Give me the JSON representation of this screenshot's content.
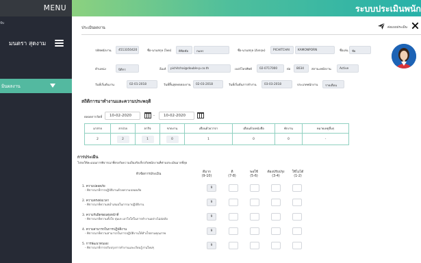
{
  "sidebar": {
    "menu_label": "MENU",
    "role_text": "จับ",
    "user_name": "มนตรา สุดงาม",
    "active_menu": "มินผลงาน"
  },
  "topbar": {
    "title": "ระบบประเมินพนัก"
  },
  "page": {
    "breadcrumb": "ประเมินผลงาน",
    "send_label": "ส่งแบบประเมิน"
  },
  "profile": {
    "employee_id_label": "รหัสพนักงาน",
    "employee_id": "4513350420",
    "first_name_th_label": "ชื่อ-นามสกุล (ไทย)",
    "first_name_th": "พิชิตชัย",
    "last_name_th": "กมลร",
    "name_en_label": "ชื่อ-นามสกุล (อังกฤษ)",
    "first_name_en": "PICHITCHAI",
    "last_name_en": "KAMONPORN",
    "nickname_label": "ชื่อเล่น",
    "nickname": "ชัย",
    "position_label": "ตำแหน่ง",
    "position": "นิติกร",
    "email_label": "อีเมล์",
    "email": "pichitchai@double-p.co.th",
    "phone_label": "เบอร์โทรศัพท์",
    "phone": "02-0717000",
    "ext_label": "ต่อ",
    "ext": "8034",
    "status_label": "สถานะพนักงาน",
    "status": "Active",
    "start_date_label": "วันที่เริ่มต้นงาน",
    "start_date": "02-01-2018",
    "probation_label": "วันที่สิ้นสุดทดลองงาน",
    "probation_date": "02-03-2018",
    "first_work_label": "วันที่เริ่มต้นการทำงาน",
    "first_work_date": "03-03-2018",
    "employee_type_label": "ประเภทพนักงาน",
    "employee_type": "รายเดือน"
  },
  "stats": {
    "section_title": "สถิติการมาทำงานและความประพฤติ",
    "period_label": "ตลอดการวัดที่",
    "date_from": "10-02-2020",
    "date_sep": "-",
    "date_to": "10-02-2020",
    "headers": [
      "มาสาย",
      "ลาป่วย",
      "ลากิจ",
      "ขาดงาน",
      "เตือนด้วยวาจา",
      "เตือนด้วยหนังสือ",
      "พักงาน",
      "หมายเหตุอื่นๆ"
    ],
    "values": [
      "2",
      "2",
      "1",
      "0",
      "1",
      "0",
      "0",
      "-"
    ]
  },
  "evaluation": {
    "title": "การประเมิน",
    "description": "โปรดให้คะแนนการพิจารณาที่ตรงกับความเป็นจริงเกี่ยวกับพนักงานที่ท่านประเมินมากที่สุด",
    "topic_header": "หัวข้อการประเมิน",
    "columns": [
      "ดีมาก\n(9-10)",
      "ดี\n(7-8)",
      "พอใช้\n(5-6)",
      "ต้องปรับปรุง\n(3-4)",
      "ใช้ไม่ได้\n(1-2)"
    ],
    "items": [
      {
        "title": "1. ความปลอดภัย",
        "sub": "- พิจารณาที่การปฏิบัติงานด้วยความปลอดภัย",
        "score": "9"
      },
      {
        "title": "2. ความตรงต่อเวลา",
        "sub": "- พิจารณาที่ความสม่ำเสมอในการมาปฏิบัติงาน",
        "score": "9"
      },
      {
        "title": "3. ความรับผิดชอบต่อหน้าที่",
        "sub": "- พิจารณาที่ความตั้งใจ ทุ่มเท เอาใจใส่ในการทำงานอย่างไม่ย่อท้อ",
        "score": "9"
      },
      {
        "title": "4. ความสามารถในการปฏิบัติงาน",
        "sub": "- พิจารณาที่ความสามารถในการปฏิบัติงานให้สำเร็จตามคุณภาพ",
        "score": "9"
      },
      {
        "title": "5. การพัฒนาตนเอง",
        "sub": "- พิจารณาที่การปรับปรุงการทำงานและเรียนรู้งานใหม่ๆ",
        "score": "9"
      }
    ]
  }
}
